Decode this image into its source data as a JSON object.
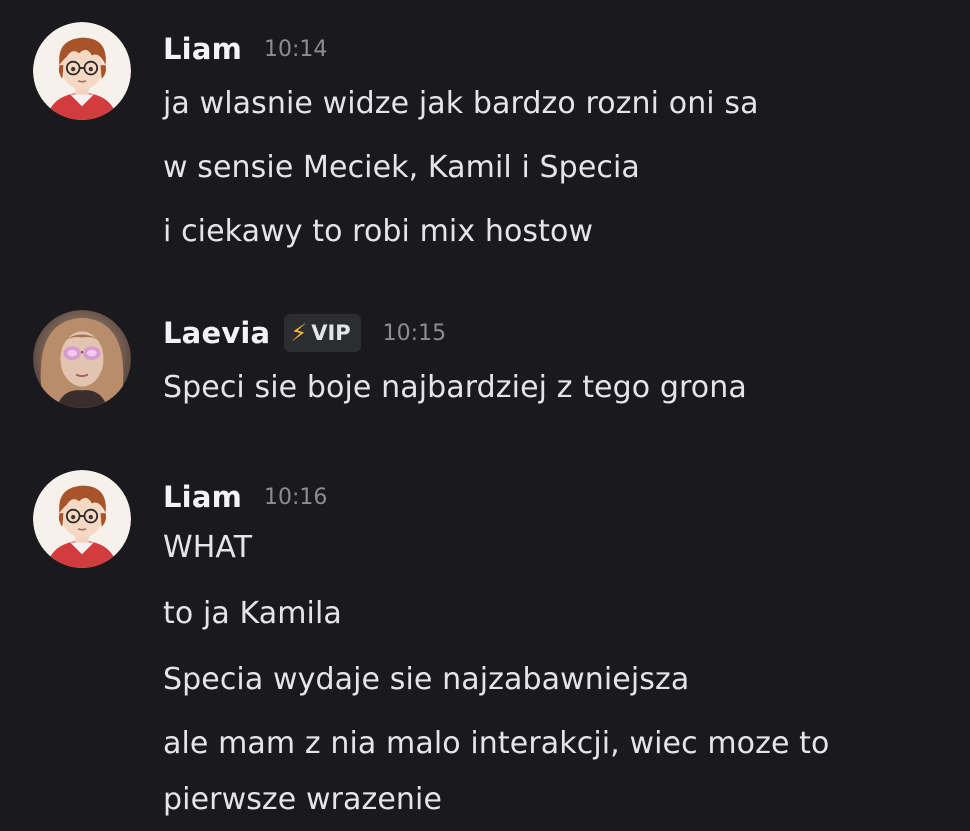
{
  "messages": [
    {
      "author": "Liam",
      "time": "10:14",
      "avatar": "anime-boy-glasses-avatar",
      "lines": [
        "ja wlasnie widze jak bardzo rozni oni sa",
        "w sensie Meciek, Kamil i Specia",
        "i ciekawy to robi mix hostow"
      ]
    },
    {
      "author": "Laevia",
      "time": "10:15",
      "avatar": "girl-sunglasses-avatar",
      "badge": {
        "icon": "lightning-icon",
        "label": "VIP",
        "color": "#f0b232"
      },
      "lines": [
        "Speci sie boje najbardziej z tego grona"
      ]
    },
    {
      "author": "Liam",
      "time": "10:16",
      "avatar": "anime-boy-glasses-avatar",
      "lines": [
        "WHAT",
        "to ja Kamila",
        "Specia wydaje sie najzabawniejsza",
        "ale mam z nia malo interakcji, wiec moze to",
        "pierwsze wrazenie"
      ]
    }
  ],
  "colors": {
    "background": "#1a1a1e",
    "username": "#f2f3f5",
    "timestamp": "#8a8d94",
    "message_text": "#e4e5e8",
    "vip_icon": "#f0b232"
  }
}
